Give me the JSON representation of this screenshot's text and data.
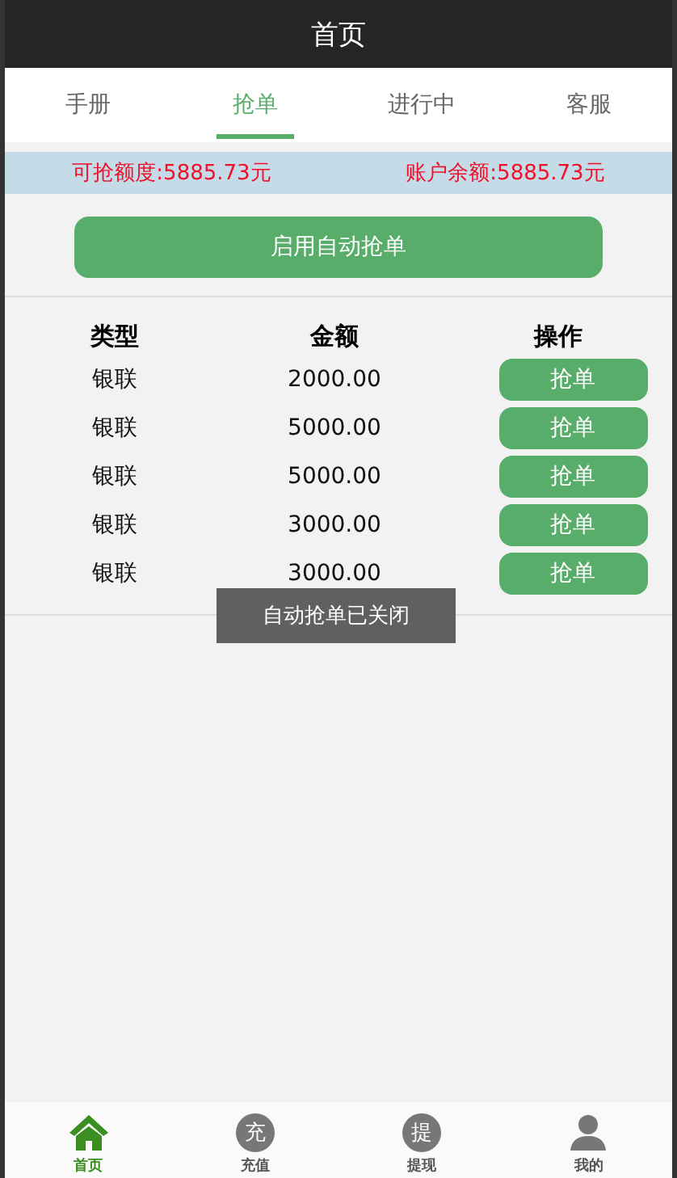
{
  "header": {
    "title": "首页"
  },
  "tabs": [
    {
      "label": "手册",
      "selected": false
    },
    {
      "label": "抢单",
      "selected": true
    },
    {
      "label": "进行中",
      "selected": false
    },
    {
      "label": "客服",
      "selected": false
    }
  ],
  "info_bar": {
    "quota": "可抢额度:5885.73元",
    "balance": "账户余额:5885.73元"
  },
  "auto_button": "启用自动抢单",
  "table": {
    "columns": [
      "类型",
      "金额",
      "操作"
    ],
    "rows": [
      {
        "type": "银联",
        "amount": "2000.00",
        "action": "抢单"
      },
      {
        "type": "银联",
        "amount": "5000.00",
        "action": "抢单"
      },
      {
        "type": "银联",
        "amount": "5000.00",
        "action": "抢单"
      },
      {
        "type": "银联",
        "amount": "3000.00",
        "action": "抢单"
      },
      {
        "type": "银联",
        "amount": "3000.00",
        "action": "抢单"
      }
    ]
  },
  "toast": "自动抢单已关闭",
  "bottom_nav": [
    {
      "kind": "home",
      "label": "首页",
      "selected": true
    },
    {
      "kind": "glyph",
      "glyph": "充",
      "label": "充值",
      "selected": false
    },
    {
      "kind": "glyph",
      "glyph": "提",
      "label": "提现",
      "selected": false
    },
    {
      "kind": "user",
      "label": "我的",
      "selected": false
    }
  ]
}
